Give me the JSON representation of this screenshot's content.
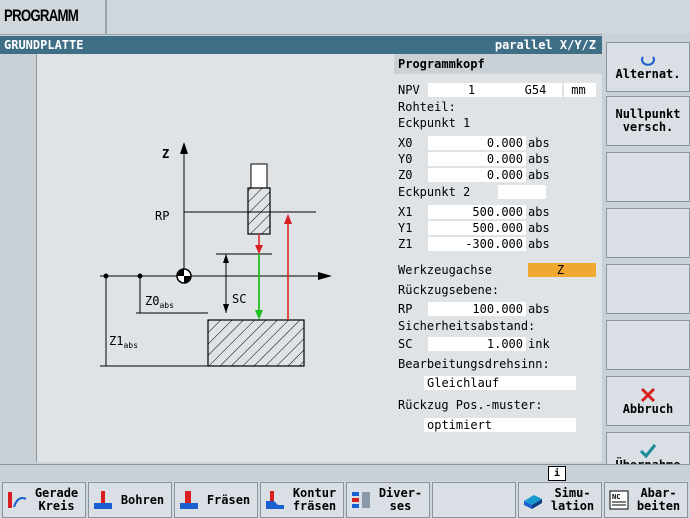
{
  "app": {
    "title": "PROGRAMM"
  },
  "header": {
    "title": "GRUNDPLATTE",
    "plane": "parallel X/Y/Z"
  },
  "graphic": {
    "labels": {
      "z": "Z",
      "rp": "RP",
      "sc": "SC",
      "z0": "Z0",
      "z0_sub": "abs",
      "z1": "Z1",
      "z1_sub": "abs"
    }
  },
  "form": {
    "section": "Programmkopf",
    "npv": {
      "label": "NPV",
      "value": "1",
      "g": "G54",
      "unit": "mm"
    },
    "rohteil": "Rohteil:",
    "eckpunkt1": "Eckpunkt 1",
    "p1": [
      {
        "label": "X0",
        "value": "0.000",
        "unit": "abs"
      },
      {
        "label": "Y0",
        "value": "0.000",
        "unit": "abs"
      },
      {
        "label": "Z0",
        "value": "0.000",
        "unit": "abs"
      }
    ],
    "eckpunkt2": "Eckpunkt 2",
    "p2": [
      {
        "label": "X1",
        "value": "500.000",
        "unit": "abs"
      },
      {
        "label": "Y1",
        "value": "500.000",
        "unit": "abs"
      },
      {
        "label": "Z1",
        "value": "-300.000",
        "unit": "abs"
      }
    ],
    "werkzeugachse": {
      "label": "Werkzeugachse",
      "value": "Z"
    },
    "rueckzugsebene": "Rückzugsebene:",
    "rp": {
      "label": "RP",
      "value": "100.000",
      "unit": "abs"
    },
    "sicherheitsabstand": "Sicherheitsabstand:",
    "sc": {
      "label": "SC",
      "value": "1.000",
      "unit": "ink"
    },
    "drehsinn": {
      "label": "Bearbeitungsdrehsinn:",
      "value": "Gleichlauf"
    },
    "rueckzug": {
      "label": "Rückzug Pos.-muster:",
      "value": "optimiert"
    }
  },
  "softkeys": {
    "alternat": "Alternat.",
    "nullpunkt1": "Nullpunkt",
    "nullpunkt2": "versch.",
    "abbruch": "Abbruch",
    "uebernahme": "Übernahme"
  },
  "hkeys": {
    "gerade1": "Gerade",
    "gerade2": "Kreis",
    "bohren": "Bohren",
    "fraesen": "Fräsen",
    "kontur1": "Kontur",
    "kontur2": "fräsen",
    "divers1": "Diver-",
    "divers2": "ses",
    "sim1": "Simu-",
    "sim2": "lation",
    "abar1": "Abar-",
    "abar2": "beiten"
  },
  "info": {
    "icon": "i"
  },
  "colors": {
    "header": "#3f6f86",
    "highlight": "#f0a830",
    "red_arrow": "#d81f1f",
    "green_arrow": "#20c020"
  }
}
